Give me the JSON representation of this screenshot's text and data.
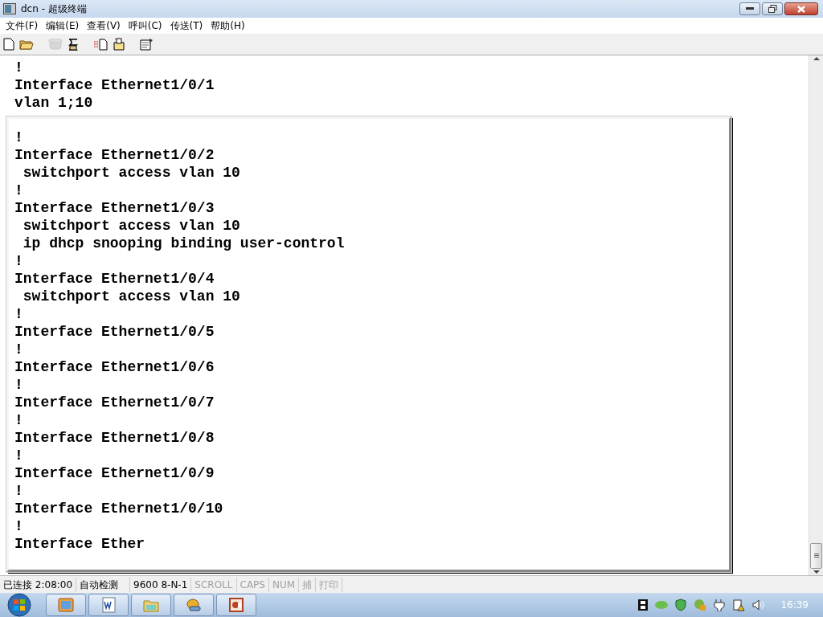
{
  "window": {
    "title": "dcn - 超级终端"
  },
  "menu": [
    {
      "label": "文件(F)"
    },
    {
      "label": "编辑(E)"
    },
    {
      "label": "查看(V)"
    },
    {
      "label": "呼叫(C)"
    },
    {
      "label": "传送(T)"
    },
    {
      "label": "帮助(H)"
    }
  ],
  "toolbar": [
    {
      "kind": "new",
      "disabled": false
    },
    {
      "kind": "open",
      "disabled": false
    },
    {
      "kind": "call",
      "disabled": true
    },
    {
      "kind": "hangup",
      "disabled": false
    },
    {
      "kind": "send",
      "disabled": false
    },
    {
      "kind": "receive",
      "disabled": false
    },
    {
      "kind": "properties",
      "disabled": false
    }
  ],
  "terminal": {
    "lines": [
      "!",
      "Interface Ethernet1/0/1",
      "vlan 1;10"
    ]
  },
  "panel": {
    "lines": [
      "!",
      "Interface Ethernet1/0/2",
      " switchport access vlan 10",
      "!",
      "Interface Ethernet1/0/3",
      " switchport access vlan 10",
      " ip dhcp snooping binding user-control",
      "!",
      "Interface Ethernet1/0/4",
      " switchport access vlan 10",
      "!",
      "Interface Ethernet1/0/5",
      "!",
      "Interface Ethernet1/0/6",
      "!",
      "Interface Ethernet1/0/7",
      "!",
      "Interface Ethernet1/0/8",
      "!",
      "Interface Ethernet1/0/9",
      "!",
      "Interface Ethernet1/0/10",
      "!",
      "Interface Ether"
    ]
  },
  "status_bar": [
    {
      "text": "已连接 2:08:00",
      "disabled": false
    },
    {
      "text": "自动检测",
      "disabled": false
    },
    {
      "text": "9600 8-N-1",
      "disabled": false
    },
    {
      "text": "SCROLL",
      "disabled": true
    },
    {
      "text": "CAPS",
      "disabled": true
    },
    {
      "text": "NUM",
      "disabled": true
    },
    {
      "text": "捕",
      "disabled": true
    },
    {
      "text": "打印",
      "disabled": true
    }
  ],
  "taskbar": {
    "apps": [
      {
        "kind": "explorer"
      },
      {
        "kind": "word"
      },
      {
        "kind": "folder"
      },
      {
        "kind": "terminal"
      },
      {
        "kind": "presentation"
      }
    ],
    "clock": "16:39"
  }
}
